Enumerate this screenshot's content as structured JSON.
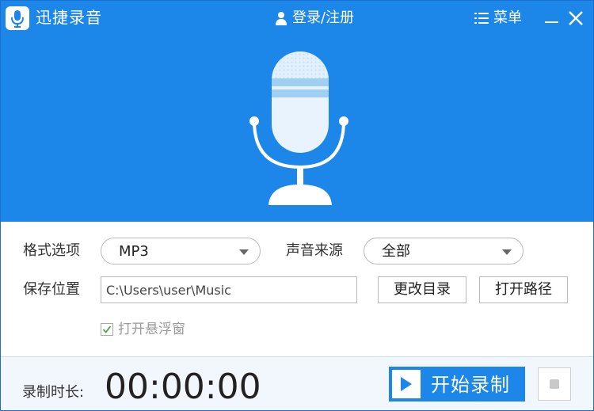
{
  "app": {
    "title": "迅捷录音",
    "accent_color": "#1c87e8"
  },
  "titlebar": {
    "login_label": "登录/注册",
    "menu_label": "菜单",
    "icons": [
      "microphone-logo-icon",
      "user-icon",
      "menu-list-icon",
      "minimize-icon",
      "close-icon"
    ]
  },
  "settings": {
    "format": {
      "label": "格式选项",
      "value": "MP3"
    },
    "source": {
      "label": "声音来源",
      "value": "全部"
    },
    "save_location": {
      "label": "保存位置",
      "path": "C:\\Users\\user\\Music",
      "change_dir_label": "更改目录",
      "open_path_label": "打开路径"
    },
    "floating_window": {
      "label": "打开悬浮窗",
      "checked": true
    }
  },
  "recording": {
    "duration_label": "录制时长:",
    "timer": "00:00:00",
    "start_label": "开始录制"
  }
}
